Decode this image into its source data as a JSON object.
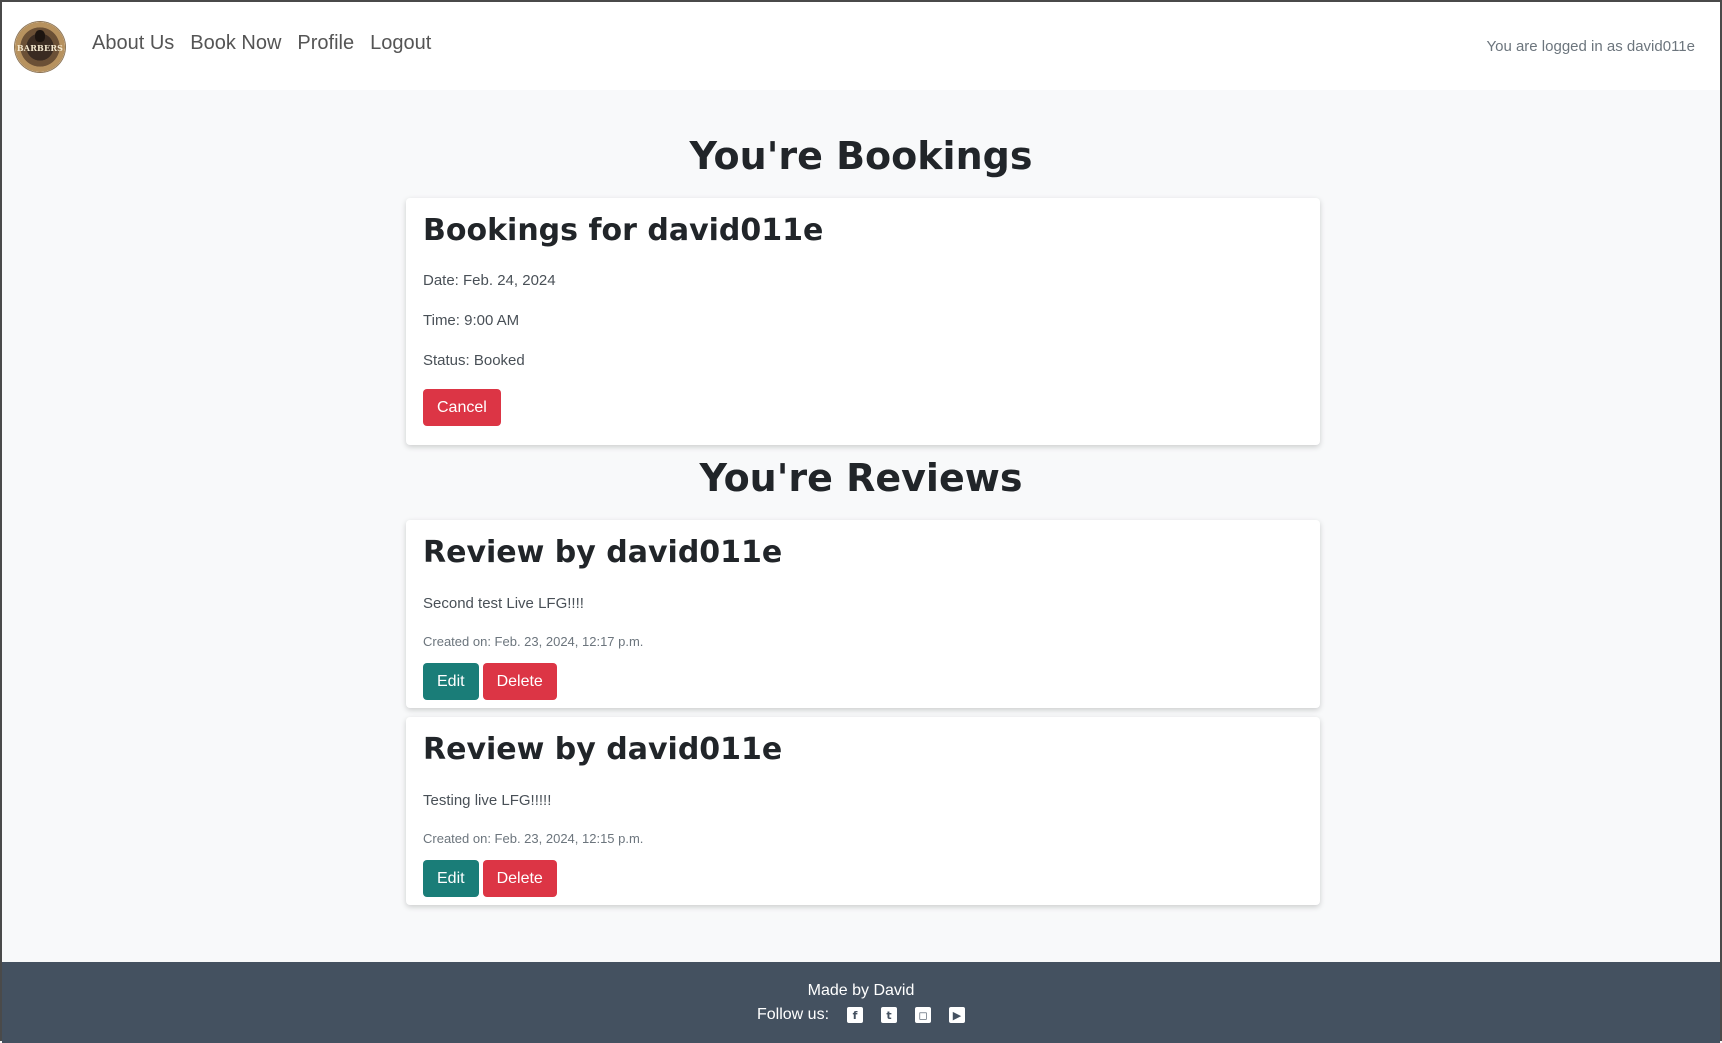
{
  "nav": {
    "logo_text": "BARBERS",
    "links": [
      "About Us",
      "Book Now",
      "Profile",
      "Logout"
    ],
    "logged_in": "You are logged in as david011e"
  },
  "bookings": {
    "title": "You're Bookings",
    "card": {
      "heading": "Bookings for david011e",
      "date": "Date: Feb. 24, 2024",
      "time": "Time: 9:00 AM",
      "status": "Status: Booked",
      "cancel_label": "Cancel"
    }
  },
  "reviews": {
    "title": "You're Reviews",
    "items": [
      {
        "heading": "Review by david011e",
        "text": "Second test Live LFG!!!!",
        "created": "Created on: Feb. 23, 2024, 12:17 p.m.",
        "edit_label": "Edit",
        "delete_label": "Delete"
      },
      {
        "heading": "Review by david011e",
        "text": "Testing live LFG!!!!!",
        "created": "Created on: Feb. 23, 2024, 12:15 p.m.",
        "edit_label": "Edit",
        "delete_label": "Delete"
      }
    ]
  },
  "footer": {
    "made_by": "Made by David",
    "follow": "Follow us:",
    "icons": [
      "facebook-icon",
      "twitter-icon",
      "instagram-icon",
      "youtube-icon"
    ]
  },
  "colors": {
    "danger": "#dc3545",
    "teal": "#1a7d78",
    "footer": "#445160"
  }
}
